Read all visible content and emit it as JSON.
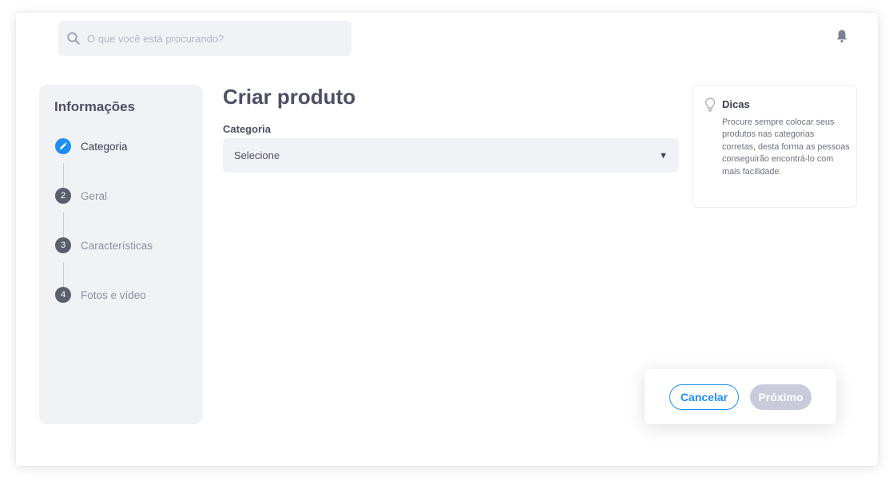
{
  "search": {
    "placeholder": "O que você está procurando?"
  },
  "icons": {
    "search": "search-icon",
    "bell": "bell-icon",
    "edit": "pencil-icon",
    "tips": "lightbulb-icon",
    "select_arrow": "caret-down-icon"
  },
  "colors": {
    "accent": "#1f8ef1",
    "step_inactive": "#5b5f6b",
    "panel_bg": "#f1f2f6",
    "disabled_button": "#c9cbda"
  },
  "sidebar": {
    "title": "Informações",
    "steps": [
      {
        "number": "1",
        "label": "Categoria",
        "active": true
      },
      {
        "number": "2",
        "label": "Geral",
        "active": false
      },
      {
        "number": "3",
        "label": "Características",
        "active": false
      },
      {
        "number": "4",
        "label": "Fotos e vídeo",
        "active": false
      }
    ]
  },
  "main": {
    "title": "Criar produto",
    "category_label": "Categoria",
    "category_select": {
      "selected": "Selecione",
      "arrow": "▼"
    }
  },
  "tips": {
    "title": "Dicas",
    "text": "Procure sempre colocar seus produtos nas categorias corretas, desta forma as pessoas conseguirão encontrá-lo com mais facilidade."
  },
  "actions": {
    "cancel_label": "Cancelar",
    "next_label": "Próximo"
  }
}
